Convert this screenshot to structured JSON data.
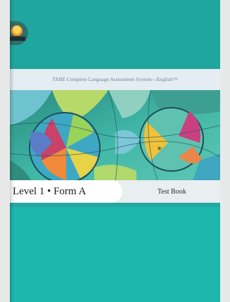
{
  "cover": {
    "series": "TABE Complete Language Assessment System—English™",
    "title": "Level 1 • Form A",
    "book_type": "Test Book",
    "colors": {
      "teal": "#1db7ae",
      "header_teal": "#1fa79f",
      "strip": "#e4edf1",
      "title_bar": "#e9eef0"
    },
    "logo_icon": "tabe-sun-logo-icon"
  }
}
